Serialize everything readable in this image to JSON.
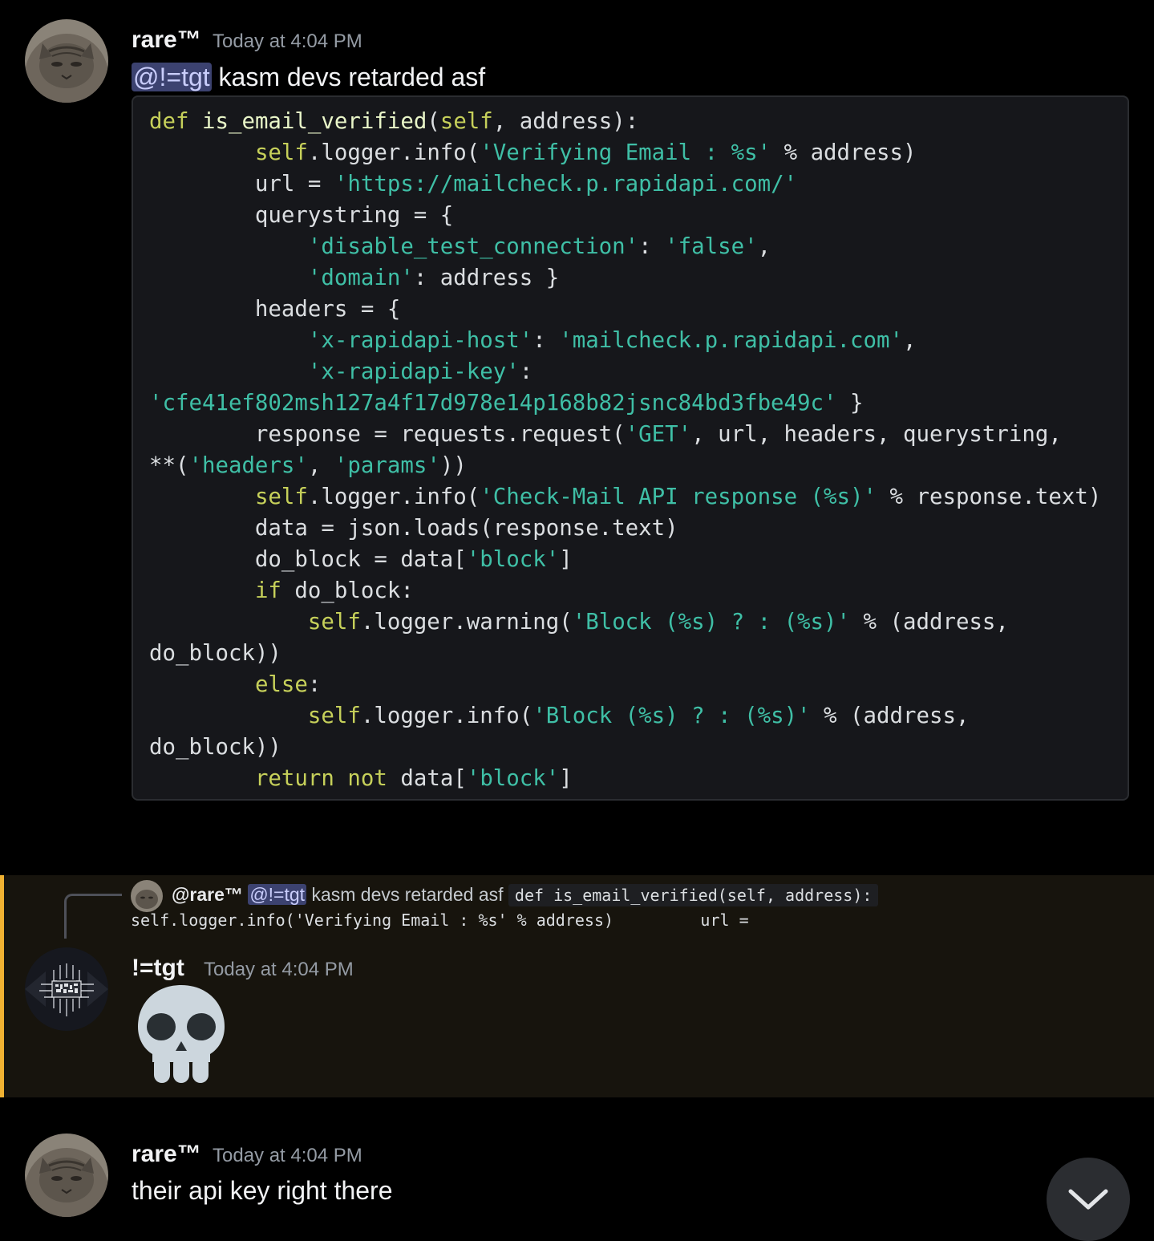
{
  "messages": [
    {
      "author": "rare™",
      "timestamp": "Today at 4:04 PM",
      "mention": "@!=tgt",
      "text": " kasm devs retarded asf"
    },
    {
      "reply": {
        "author": "@rare™",
        "mention": "@!=tgt",
        "text": "kasm devs retarded asf",
        "code_preview": "def is_email_verified(self, address):",
        "code_preview_line2": "self.logger.info('Verifying Email : %s' % address)         url ="
      },
      "author": "!=tgt",
      "timestamp": "Today at 4:04 PM",
      "emoji": "skull"
    },
    {
      "author": "rare™",
      "timestamp": "Today at 4:04 PM",
      "text": "their api key right there"
    }
  ],
  "colors": {
    "background": "#000000",
    "mention_highlight": "#17140d",
    "mention_bar": "#f0b232",
    "mention_pill": "#3c4270"
  },
  "icons": {
    "jump_button": "chevron-down-icon"
  }
}
